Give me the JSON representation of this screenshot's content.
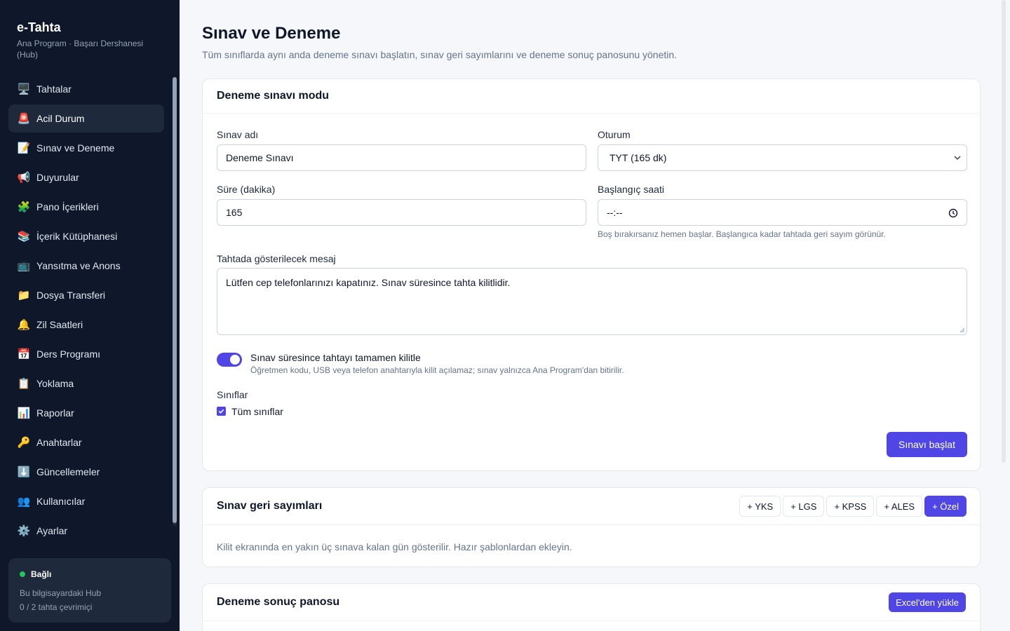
{
  "brand": {
    "title": "e-Tahta",
    "subtitle": "Ana Program · Başarı Dershanesi (Hub)"
  },
  "sidebar": {
    "items": [
      {
        "label": "Tahtalar",
        "icon": "🖥️",
        "icon_name": "desktop-icon"
      },
      {
        "label": "Acil Durum",
        "icon": "🚨",
        "icon_name": "siren-icon"
      },
      {
        "label": "Sınav ve Deneme",
        "icon": "📝",
        "icon_name": "memo-icon"
      },
      {
        "label": "Duyurular",
        "icon": "📢",
        "icon_name": "megaphone-icon"
      },
      {
        "label": "Pano İçerikleri",
        "icon": "🧩",
        "icon_name": "puzzle-icon"
      },
      {
        "label": "İçerik Kütüphanesi",
        "icon": "📚",
        "icon_name": "books-icon"
      },
      {
        "label": "Yansıtma ve Anons",
        "icon": "📺",
        "icon_name": "tv-icon"
      },
      {
        "label": "Dosya Transferi",
        "icon": "📁",
        "icon_name": "folder-icon"
      },
      {
        "label": "Zil Saatleri",
        "icon": "🔔",
        "icon_name": "bell-icon"
      },
      {
        "label": "Ders Programı",
        "icon": "📅",
        "icon_name": "calendar-icon"
      },
      {
        "label": "Yoklama",
        "icon": "📋",
        "icon_name": "clipboard-icon"
      },
      {
        "label": "Raporlar",
        "icon": "📊",
        "icon_name": "bar-chart-icon"
      },
      {
        "label": "Anahtarlar",
        "icon": "🔑",
        "icon_name": "key-icon"
      },
      {
        "label": "Güncellemeler",
        "icon": "⬇️",
        "icon_name": "download-icon"
      },
      {
        "label": "Kullanıcılar",
        "icon": "👥",
        "icon_name": "users-icon"
      },
      {
        "label": "Ayarlar",
        "icon": "⚙️",
        "icon_name": "gear-icon"
      }
    ],
    "active_index": 1,
    "status": {
      "label": "Bağlı",
      "line1": "Bu bilgisayardaki Hub",
      "line2": "0 / 2 tahta çevrimiçi"
    }
  },
  "page": {
    "title": "Sınav ve Deneme",
    "subtitle": "Tüm sınıflarda aynı anda deneme sınavı başlatın, sınav geri sayımlarını ve deneme sonuç panosunu yönetin."
  },
  "exam_mode": {
    "title": "Deneme sınavı modu",
    "name_label": "Sınav adı",
    "name_value": "Deneme Sınavı",
    "session_label": "Oturum",
    "session_value": "TYT (165 dk)",
    "duration_label": "Süre (dakika)",
    "duration_value": "165",
    "start_label": "Başlangıç saati",
    "start_value": "--:--",
    "start_hint": "Boş bırakırsanız hemen başlar. Başlangıca kadar tahtada geri sayım görünür.",
    "message_label": "Tahtada gösterilecek mesaj",
    "message_value": "Lütfen cep telefonlarınızı kapatınız. Sınav süresince tahta kilitlidir.",
    "lock_label": "Sınav süresince tahtayı tamamen kilitle",
    "lock_hint": "Öğretmen kodu, USB veya telefon anahtarıyla kilit açılamaz; sınav yalnızca Ana Program'dan bitirilir.",
    "lock_on": true,
    "classes_label": "Sınıflar",
    "all_classes_label": "Tüm sınıflar",
    "all_classes_checked": true,
    "start_button": "Sınavı başlat"
  },
  "countdowns": {
    "title": "Sınav geri sayımları",
    "chips": [
      "+ YKS",
      "+ LGS",
      "+ KPSS",
      "+ ALES",
      "+ Özel"
    ],
    "description": "Kilit ekranında en yakın üç sınava kalan gün gösterilir. Hazır şablonlardan ekleyin."
  },
  "results": {
    "title": "Deneme sonuç panosu",
    "upload_button": "Excel'den yükle"
  },
  "colors": {
    "sidebar_bg": "#0f172a",
    "accent": "#4f46e5",
    "status_green": "#22c55e"
  }
}
